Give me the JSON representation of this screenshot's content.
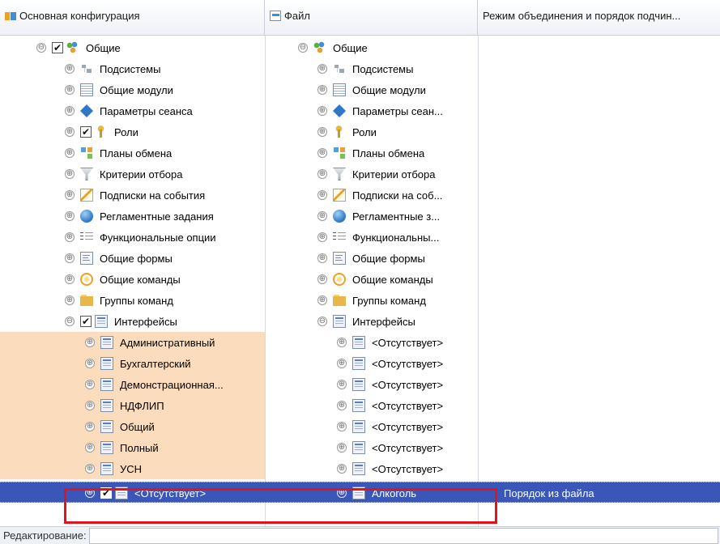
{
  "columns": {
    "col1": "Основная конфигурация",
    "col2": "Файл",
    "col3": "Режим объединения и порядок подчин..."
  },
  "rows": [
    {
      "c1": "Общие",
      "c2": "Общие",
      "icon": "group-icon",
      "exp1": "⊖",
      "exp2": "⊖",
      "check": "✔"
    },
    {
      "c1": "Подсистемы",
      "c2": "Подсистемы",
      "icon": "subsystems-icon"
    },
    {
      "c1": "Общие модули",
      "c2": "Общие модули",
      "icon": "module-icon"
    },
    {
      "c1": "Параметры сеанса",
      "c2": "Параметры сеан...",
      "icon": "diamond-icon"
    },
    {
      "c1": "Роли",
      "c2": "Роли",
      "icon": "key-icon",
      "check": "✔"
    },
    {
      "c1": "Планы обмена",
      "c2": "Планы обмена",
      "icon": "exchange-icon"
    },
    {
      "c1": "Критерии отбора",
      "c2": "Критерии отбора",
      "icon": "filter-icon"
    },
    {
      "c1": "Подписки на события",
      "c2": "Подписки на соб...",
      "icon": "lightning-icon"
    },
    {
      "c1": "Регламентные задания",
      "c2": "Регламентные з...",
      "icon": "globe-icon"
    },
    {
      "c1": "Функциональные опции",
      "c2": "Функциональны...",
      "icon": "options-icon"
    },
    {
      "c1": "Общие формы",
      "c2": "Общие формы",
      "icon": "form-icon"
    },
    {
      "c1": "Общие команды",
      "c2": "Общие команды",
      "icon": "command-icon"
    },
    {
      "c1": "Группы команд",
      "c2": "Группы команд",
      "icon": "folder-icon"
    },
    {
      "c1": "Интерфейсы",
      "c2": "Интерфейсы",
      "icon": "interface-icon",
      "exp1": "⊖",
      "exp2": "⊖",
      "check": "✔"
    },
    {
      "c1": "Административный",
      "c2": "<Отсутствует>",
      "icon": "interface-icon"
    },
    {
      "c1": "Бухгалтерский",
      "c2": "<Отсутствует>",
      "icon": "interface-icon"
    },
    {
      "c1": "Демонстрационная...",
      "c2": "<Отсутствует>",
      "icon": "interface-icon"
    },
    {
      "c1": "НДФЛИП",
      "c2": "<Отсутствует>",
      "icon": "interface-icon"
    },
    {
      "c1": "Общий",
      "c2": "<Отсутствует>",
      "icon": "interface-icon"
    },
    {
      "c1": "Полный",
      "c2": "<Отсутствует>",
      "icon": "interface-icon"
    },
    {
      "c1": "УСН",
      "c2": "<Отсутствует>",
      "icon": "interface-icon"
    }
  ],
  "selected_row": {
    "c1": "<Отсутствует>",
    "c2": "Алкоголь",
    "c3": "Порядок из файла",
    "icon": "interface-icon",
    "check": "✔"
  },
  "expander_plus": "⊕",
  "footer": {
    "label": "Редактирование:"
  },
  "colors": {
    "highlight": "#fbdcbc",
    "selection": "#3a56b8",
    "annotation_box": "#e1141c"
  }
}
